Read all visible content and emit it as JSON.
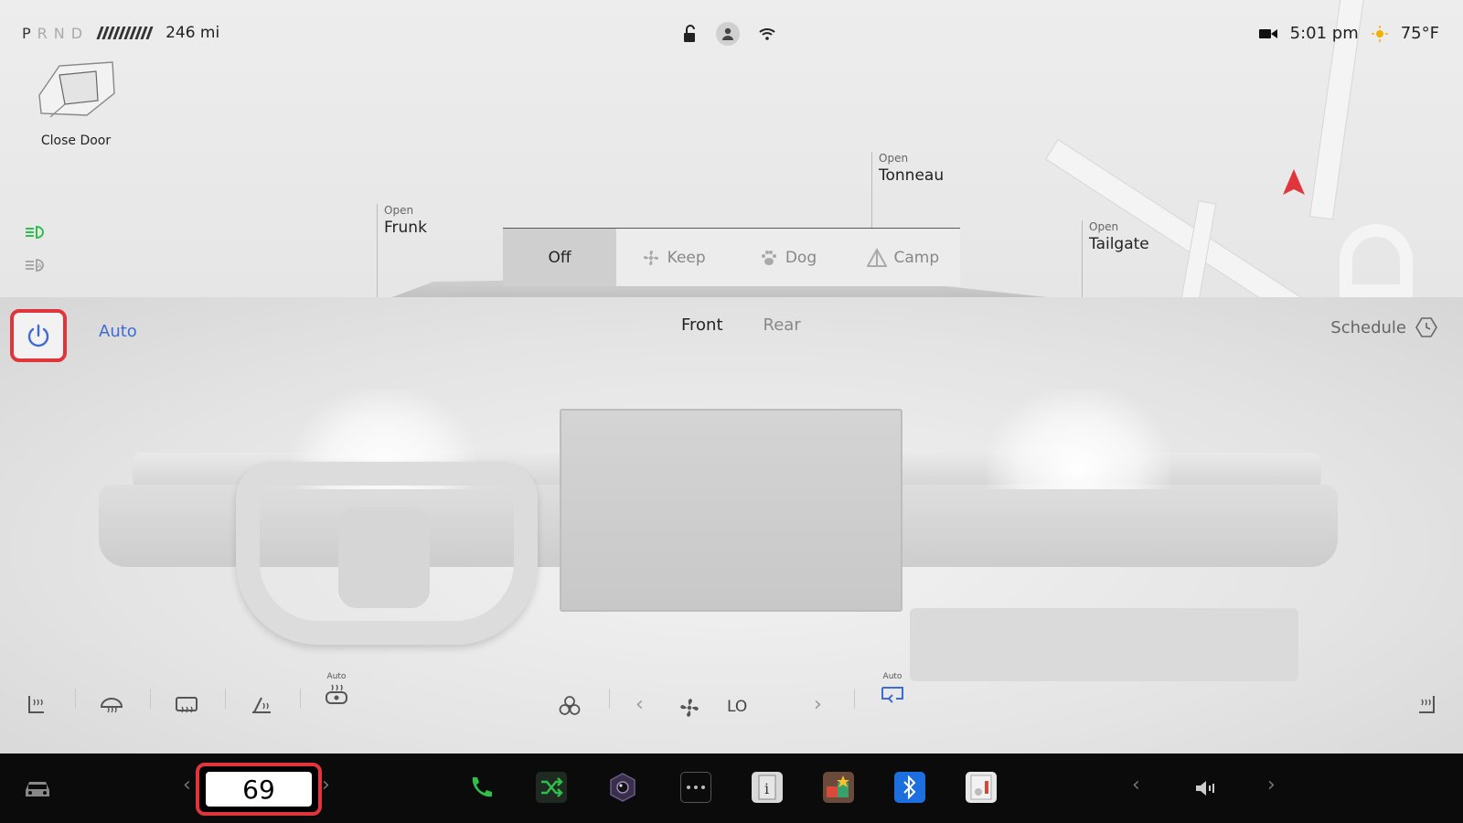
{
  "status_bar": {
    "gears": [
      "P",
      "R",
      "N",
      "D"
    ],
    "active_gear": "P",
    "range": "246 mi",
    "time": "5:01 pm",
    "temperature": "75°F"
  },
  "vehicle": {
    "close_door_label": "Close Door",
    "frunk": {
      "action": "Open",
      "name": "Frunk"
    },
    "tonneau": {
      "action": "Open",
      "name": "Tonneau"
    },
    "tailgate": {
      "action": "Open",
      "name": "Tailgate"
    }
  },
  "climate_modes": {
    "items": [
      {
        "label": "Off",
        "icon": "off",
        "selected": true
      },
      {
        "label": "Keep",
        "icon": "fan-icon",
        "selected": false
      },
      {
        "label": "Dog",
        "icon": "paw-icon",
        "selected": false
      },
      {
        "label": "Camp",
        "icon": "tent-icon",
        "selected": false
      }
    ]
  },
  "climate": {
    "auto_label": "Auto",
    "tabs": [
      {
        "label": "Front",
        "active": true
      },
      {
        "label": "Rear",
        "active": false
      }
    ],
    "schedule_label": "Schedule",
    "fan_level": "LO",
    "steering_heat_auto": "Auto",
    "recirc_auto": "Auto"
  },
  "dock": {
    "cabin_temp": "69",
    "apps": [
      "phone-icon",
      "shuffle-icon",
      "camera-app-icon",
      "more-apps-icon",
      "manual-icon",
      "toybox-icon",
      "bluetooth-icon",
      "dashcam-viewer-icon"
    ]
  },
  "colors": {
    "accent_blue": "#3e6bd6",
    "highlight_red": "#e0353a",
    "green_light": "#2fbf4a",
    "dock_bg": "#0b0b0b"
  }
}
